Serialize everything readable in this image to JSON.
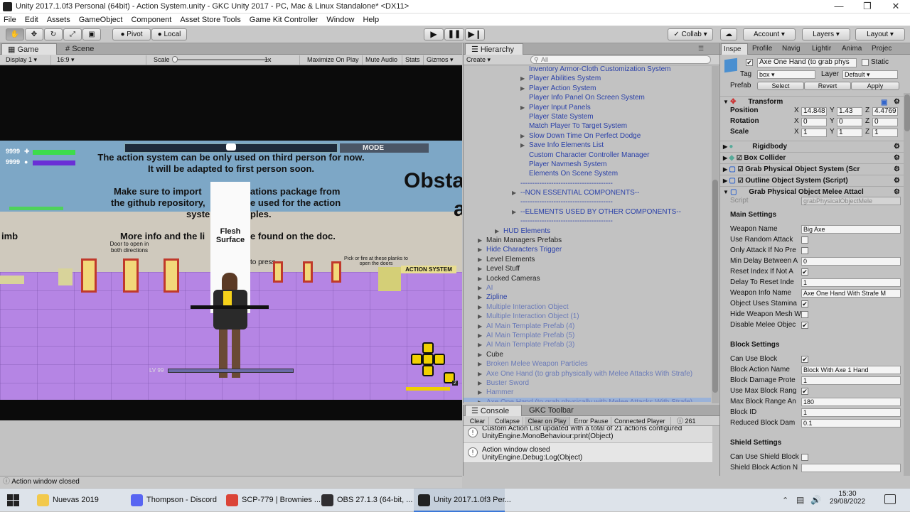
{
  "window": {
    "title": "Unity 2017.1.0f3 Personal (64bit) - Action System.unity - GKC Unity 2017 - PC, Mac & Linux Standalone* <DX11>"
  },
  "menu": [
    "File",
    "Edit",
    "Assets",
    "GameObject",
    "Component",
    "Asset Store Tools",
    "Game Kit Controller",
    "Window",
    "Help"
  ],
  "toolbar": {
    "pivot": "Pivot",
    "local": "Local",
    "collab": "Collab",
    "account": "Account",
    "layers": "Layers",
    "layout": "Layout"
  },
  "game": {
    "tabs": {
      "game": "Game",
      "scene": "Scene"
    },
    "display": "Display 1",
    "aspect": "16:9",
    "scale_label": "Scale",
    "scale_value": "1x",
    "maximize": "Maximize On Play",
    "mute": "Mute Audio",
    "stats": "Stats",
    "gizmos": "Gizmos",
    "mode": "MODE",
    "hp": "9999",
    "mp": "9999",
    "msg1": "The action system can be only used on third person for now.",
    "msg2": "It will be adapted to first person soon.",
    "msg3a": "Make sure to import",
    "msg3b": "ations package from",
    "msg4a": "the github repository,",
    "msg4b": "e used for the action",
    "msg5a": "syste",
    "msg5b": "ples.",
    "msg6a": "More info and the li",
    "msg6b": "e found on the doc.",
    "obsta": "Obsta",
    "a": "a",
    "imb": "imb",
    "flesh": "Flesh Surface",
    "door_text": "Door to open in both directions",
    "press": "to press",
    "planks": "Pick or fire at these planks to open the doors",
    "action_system": "ACTION SYSTEM",
    "level": "LV 99",
    "badge": "2"
  },
  "status": "Action window closed",
  "hierarchy": {
    "title": "Hierarchy",
    "create": "Create",
    "search": "All",
    "items": [
      {
        "t": "Inventory Armor-Cloth Customization System",
        "c": "blue",
        "i": 80,
        "a": ""
      },
      {
        "t": "Player Abilities System",
        "c": "blue",
        "i": 80,
        "a": "▶"
      },
      {
        "t": "Player Action System",
        "c": "blue",
        "i": 80,
        "a": "▶"
      },
      {
        "t": "Player Info Panel On Screen System",
        "c": "blue",
        "i": 80,
        "a": ""
      },
      {
        "t": "Player Input Panels",
        "c": "blue",
        "i": 80,
        "a": "▶"
      },
      {
        "t": "Player State System",
        "c": "blue",
        "i": 80,
        "a": ""
      },
      {
        "t": "Match Player To Target System",
        "c": "blue",
        "i": 80,
        "a": ""
      },
      {
        "t": "Slow Down Time On Perfect Dodge",
        "c": "blue",
        "i": 80,
        "a": "▶"
      },
      {
        "t": "Save Info Elements List",
        "c": "blue",
        "i": 80,
        "a": "▶"
      },
      {
        "t": "Custom Character Controller Manager",
        "c": "blue",
        "i": 80,
        "a": ""
      },
      {
        "t": "Player Navmesh System",
        "c": "blue",
        "i": 80,
        "a": ""
      },
      {
        "t": "Elements On Scene System",
        "c": "blue",
        "i": 80,
        "a": ""
      },
      {
        "t": "---------------------------------------",
        "c": "blue",
        "i": 68,
        "a": ""
      },
      {
        "t": "--NON ESSENTIAL COMPONENTS--",
        "c": "blue",
        "i": 68,
        "a": "▶"
      },
      {
        "t": "---------------------------------------",
        "c": "blue",
        "i": 68,
        "a": ""
      },
      {
        "t": "--ELEMENTS USED BY OTHER COMPONENTS--",
        "c": "blue",
        "i": 68,
        "a": "▶"
      },
      {
        "t": "---------------------------------------",
        "c": "blue",
        "i": 68,
        "a": ""
      },
      {
        "t": "HUD Elements",
        "c": "blue",
        "i": 44,
        "a": "▶"
      },
      {
        "t": "Main Managers Prefabs",
        "c": "black",
        "i": 20,
        "a": "▶"
      },
      {
        "t": "Hide Characters Trigger",
        "c": "blue",
        "i": 20,
        "a": "▶"
      },
      {
        "t": "Level Elements",
        "c": "black",
        "i": 20,
        "a": "▶"
      },
      {
        "t": "Level Stuff",
        "c": "black",
        "i": 20,
        "a": "▶"
      },
      {
        "t": "Locked Cameras",
        "c": "black",
        "i": 20,
        "a": "▶"
      },
      {
        "t": "AI",
        "c": "pfade",
        "i": 20,
        "a": "▶"
      },
      {
        "t": "Zipline",
        "c": "blue",
        "i": 20,
        "a": "▶"
      },
      {
        "t": "Multiple Interaction Object",
        "c": "pfade",
        "i": 20,
        "a": "▶"
      },
      {
        "t": "Multiple Interaction Object (1)",
        "c": "pfade",
        "i": 20,
        "a": "▶"
      },
      {
        "t": "AI Main Template Prefab (4)",
        "c": "pfade",
        "i": 20,
        "a": "▶"
      },
      {
        "t": "AI Main Template Prefab (5)",
        "c": "pfade",
        "i": 20,
        "a": "▶"
      },
      {
        "t": "AI Main Template Prefab (3)",
        "c": "pfade",
        "i": 20,
        "a": "▶"
      },
      {
        "t": "Cube",
        "c": "black",
        "i": 20,
        "a": "▶"
      },
      {
        "t": "Broken Melee Weapon Particles",
        "c": "pfade",
        "i": 20,
        "a": "▶"
      },
      {
        "t": "Axe One Hand (to grab physically with Melee Attacks With Strafe)",
        "c": "pfade",
        "i": 20,
        "a": "▶"
      },
      {
        "t": "Buster Sword",
        "c": "pfade",
        "i": 20,
        "a": "▶"
      },
      {
        "t": "Hammer",
        "c": "pfade",
        "i": 20,
        "a": "▶"
      },
      {
        "t": "Axe One Hand (to grab physically with Melee Attacks With Strafe)",
        "c": "sel",
        "i": 20,
        "a": "▶"
      }
    ]
  },
  "console": {
    "tab": "Console",
    "gkc": "GKC Toolbar",
    "buttons": [
      "Clear",
      "Collapse",
      "Clear on Play",
      "Error Pause",
      "Connected Player"
    ],
    "count": "261",
    "msg1a": "Custom Action List updated with a total of 21 actions configured",
    "msg1b": "UnityEngine.MonoBehaviour:print(Object)",
    "msg2a": "Action window closed",
    "msg2b": "UnityEngine.Debug:Log(Object)"
  },
  "inspector": {
    "tabs": [
      "Inspe",
      "Profile",
      "Navig",
      "Lightir",
      "Anima",
      "Projec"
    ],
    "object_name": "Axe One Hand (to grab phys",
    "static": "Static",
    "tag_label": "Tag",
    "tag": "box",
    "layer_label": "Layer",
    "layer": "Default",
    "prefab_label": "Prefab",
    "select": "Select",
    "revert": "Revert",
    "apply": "Apply",
    "transform": "Transform",
    "position": {
      "label": "Position",
      "x": "14.848",
      "y": "1.43",
      "z": "4.4769"
    },
    "rotation": {
      "label": "Rotation",
      "x": "0",
      "y": "0",
      "z": "0"
    },
    "scale": {
      "label": "Scale",
      "x": "1",
      "y": "1",
      "z": "1"
    },
    "components": [
      "Rigidbody",
      "Box Collider",
      "Grab Physical Object System (Scr",
      "Outline Object System (Script)",
      "Grab Physical Object Melee Attacl"
    ],
    "script_label": "Script",
    "script": "grabPhysicalObjectMele",
    "main_settings": "Main Settings",
    "main_rows": [
      {
        "l": "Weapon Name",
        "v": "Big Axe",
        "k": "text"
      },
      {
        "l": "Use Random Attack",
        "v": "",
        "k": "chk"
      },
      {
        "l": "Only Attack If No Pre",
        "v": "",
        "k": "chk"
      },
      {
        "l": "Min Delay Between A",
        "v": "0",
        "k": "text"
      },
      {
        "l": "Reset Index If Not A",
        "v": "✔",
        "k": "chk"
      },
      {
        "l": "Delay To Reset Inde",
        "v": "1",
        "k": "text"
      },
      {
        "l": "Weapon Info Name",
        "v": "Axe One Hand With Strafe M",
        "k": "text"
      },
      {
        "l": "Object Uses Stamina",
        "v": "✔",
        "k": "chk"
      },
      {
        "l": "Hide Weapon Mesh W",
        "v": "",
        "k": "chk"
      },
      {
        "l": "Disable Melee Objec",
        "v": "✔",
        "k": "chk"
      }
    ],
    "block_settings": "Block Settings",
    "block_rows": [
      {
        "l": "Can Use Block",
        "v": "✔",
        "k": "chk"
      },
      {
        "l": "Block Action Name",
        "v": "Block With Axe 1 Hand",
        "k": "text"
      },
      {
        "l": "Block Damage Prote",
        "v": "1",
        "k": "text"
      },
      {
        "l": "Use Max Block Rang",
        "v": "✔",
        "k": "chk"
      },
      {
        "l": "Max Block Range An",
        "v": "180",
        "k": "text"
      },
      {
        "l": "Block ID",
        "v": "1",
        "k": "text"
      },
      {
        "l": "Reduced Block Dam",
        "v": "0.1",
        "k": "text"
      }
    ],
    "shield_settings": "Shield Settings",
    "shield_rows": [
      {
        "l": "Can Use Shield Block",
        "v": "",
        "k": "chk"
      },
      {
        "l": "Shield Block Action N",
        "v": "",
        "k": "text"
      }
    ]
  },
  "taskbar": {
    "items": [
      {
        "label": "Nuevas 2019",
        "color": "#f2c94c"
      },
      {
        "label": "Thompson - Discord",
        "color": "#5865f2"
      },
      {
        "label": "SCP-779 | Brownies ...",
        "color": "#db4437"
      },
      {
        "label": "OBS 27.1.3 (64-bit, ...",
        "color": "#302e31"
      },
      {
        "label": "Unity 2017.1.0f3 Per...",
        "color": "#222222"
      }
    ],
    "time": "15:30",
    "date": "29/08/2022"
  }
}
